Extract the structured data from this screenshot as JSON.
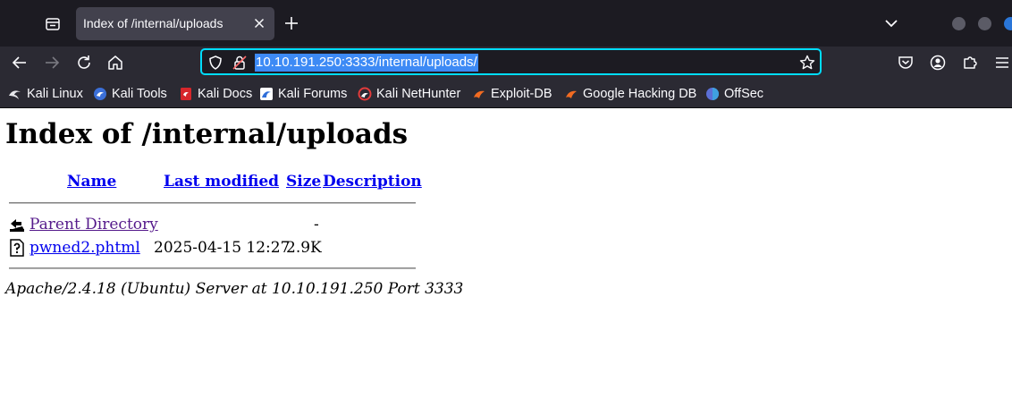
{
  "browser": {
    "tab": {
      "title": "Index of /internal/uploads"
    },
    "urlbar": {
      "url": "10.10.191.250:3333/internal/uploads/"
    },
    "bookmarks": [
      {
        "label": "Kali Linux",
        "icon": "kali-dragon-icon"
      },
      {
        "label": "Kali Tools",
        "icon": "kali-tools-icon"
      },
      {
        "label": "Kali Docs",
        "icon": "kali-docs-icon"
      },
      {
        "label": "Kali Forums",
        "icon": "kali-forums-icon"
      },
      {
        "label": "Kali NetHunter",
        "icon": "kali-nethunter-icon"
      },
      {
        "label": "Exploit-DB",
        "icon": "exploit-db-icon"
      },
      {
        "label": "Google Hacking DB",
        "icon": "ghdb-icon"
      },
      {
        "label": "OffSec",
        "icon": "offsec-icon"
      }
    ]
  },
  "page": {
    "title": "Index of /internal/uploads",
    "columns": {
      "name": "Name",
      "modified": "Last modified",
      "size": "Size",
      "description": "Description"
    },
    "rows": [
      {
        "name": "Parent Directory",
        "modified": "",
        "size": "-",
        "description": "",
        "icon": "back-arrow-icon"
      },
      {
        "name": "pwned2.phtml",
        "modified": "2025-04-15 12:27",
        "size": "2.9K",
        "description": "",
        "icon": "unknown-file-icon"
      }
    ],
    "footer": "Apache/2.4.18 (Ubuntu) Server at 10.10.191.250 Port 3333"
  },
  "colors": {
    "tabstrip": "#1c1b22",
    "toolbar": "#2b2a33",
    "urlbar_focus": "#00ddff",
    "selection": "#3d8af5",
    "link": "#0000ee",
    "visited_link": "#551a8b"
  }
}
